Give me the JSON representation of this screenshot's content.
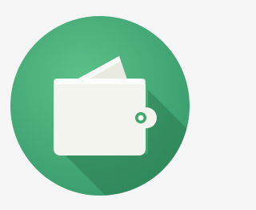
{
  "icon": {
    "name": "wallet-icon",
    "colors": {
      "background": "#f5f5f5",
      "circle": "#3fa76e",
      "circle_highlight": "#5cc08a",
      "long_shadow": "#2a7a4e",
      "wallet_body": "#f3f4ee",
      "card": "#e9ebe3",
      "clasp_ring": "#3fa76e"
    }
  }
}
